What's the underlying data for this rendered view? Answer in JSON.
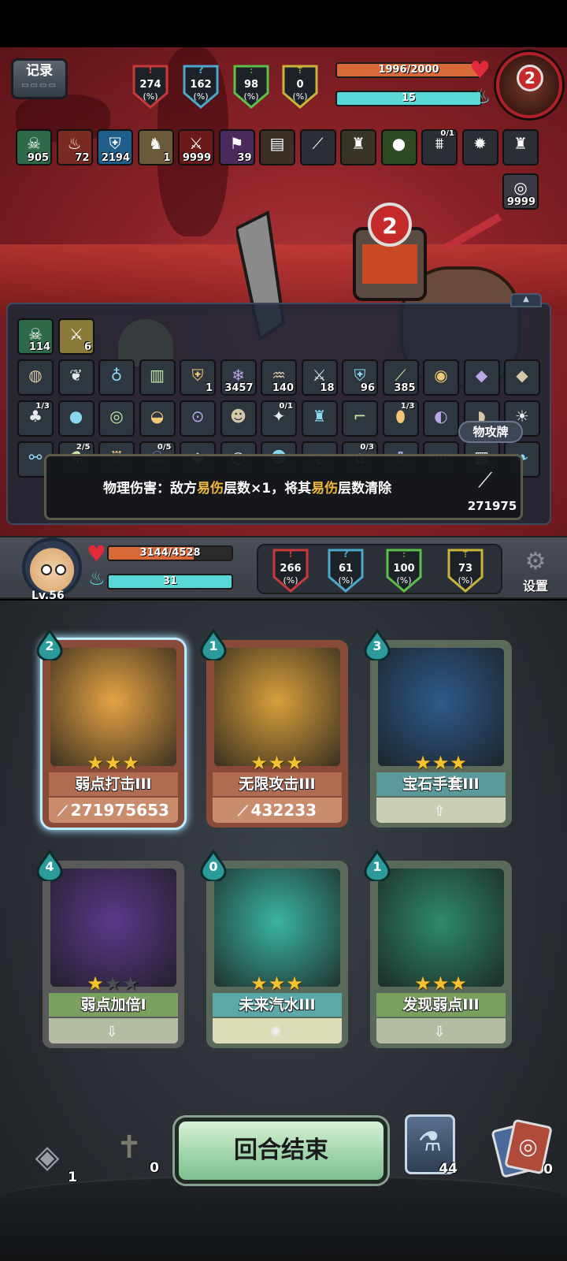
{
  "enemy": {
    "record_label": "记录",
    "hp_text": "1996/2000",
    "hp_fraction": 0.998,
    "mana_text": "15",
    "mana_fraction": 1.0,
    "portrait_number": "2",
    "stats": [
      {
        "icon": "attack-icon",
        "glyph": "!",
        "value": "274",
        "pct": "(%)",
        "color": "#c83a3a"
      },
      {
        "icon": "crit-icon",
        "glyph": "?",
        "value": "162",
        "pct": "(%)",
        "color": "#4aa8c8"
      },
      {
        "icon": "defense-icon",
        "glyph": "⫶",
        "value": "98",
        "pct": "(%)",
        "color": "#5cbf4a"
      },
      {
        "icon": "dodge-icon",
        "glyph": "⇡",
        "value": "0",
        "pct": "(%)",
        "color": "#c8b43a"
      }
    ],
    "status_icons": [
      {
        "name": "skull-icon",
        "glyph": "☠",
        "count": "905",
        "bg": "#2e6a4a"
      },
      {
        "name": "flame-icon",
        "glyph": "♨",
        "count": "72",
        "bg": "#7a2a22"
      },
      {
        "name": "shield-icon",
        "glyph": "⛨",
        "count": "2194",
        "bg": "#1f5e8a"
      },
      {
        "name": "rhino-icon",
        "glyph": "♞",
        "count": "1",
        "bg": "#6a5a3a"
      },
      {
        "name": "claw-icon",
        "glyph": "⚔",
        "count": "9999",
        "bg": "#6a1a1a"
      },
      {
        "name": "demon-icon",
        "glyph": "⚑",
        "count": "39",
        "bg": "#4a2a5a"
      },
      {
        "name": "book-icon",
        "glyph": "▤",
        "count": "",
        "bg": "#3a3026"
      },
      {
        "name": "tusk-icon",
        "glyph": "⟋",
        "count": "",
        "bg": "#2c2e36"
      },
      {
        "name": "armor-icon",
        "glyph": "♜",
        "count": "",
        "bg": "#3a3428"
      },
      {
        "name": "slime-icon",
        "glyph": "●",
        "count": "",
        "bg": "#2e4a22"
      },
      {
        "name": "jaw-icon",
        "glyph": "⩩",
        "count": "",
        "top": "0/1",
        "bg": "#2c2e36"
      },
      {
        "name": "spike-icon",
        "glyph": "✹",
        "count": "",
        "bg": "#2c2e36"
      },
      {
        "name": "boar-icon",
        "glyph": "♜",
        "count": "",
        "bg": "#2c2e36"
      }
    ],
    "extra_icon": {
      "name": "vortex-icon",
      "glyph": "◎",
      "count": "9999"
    }
  },
  "inventory": {
    "header_icons": [
      {
        "name": "skull-icon",
        "glyph": "☠",
        "count": "114",
        "bg": "#2e6a4a"
      },
      {
        "name": "sword-icon",
        "glyph": "⚔",
        "count": "6",
        "bg": "#8a7a3a"
      }
    ],
    "rows": [
      [
        {
          "name": "shield-wood-icon",
          "glyph": "◍",
          "count": ""
        },
        {
          "name": "wings-icon",
          "glyph": "❦",
          "count": ""
        },
        {
          "name": "bag-icon",
          "glyph": "♁",
          "count": ""
        },
        {
          "name": "scroll-icon",
          "glyph": "▥",
          "count": ""
        },
        {
          "name": "ice-shield-icon",
          "glyph": "⛨",
          "count": "1"
        },
        {
          "name": "frost-icon",
          "glyph": "❄",
          "count": "3457"
        },
        {
          "name": "poison-icon",
          "glyph": "♒",
          "count": "140"
        },
        {
          "name": "bleed-icon",
          "glyph": "⚔",
          "count": "18"
        },
        {
          "name": "block-icon",
          "glyph": "⛨",
          "count": "96"
        },
        {
          "name": "slash-icon",
          "glyph": "⟋",
          "count": "385"
        },
        {
          "name": "eye-icon",
          "glyph": "◉",
          "count": ""
        },
        {
          "name": "crystal-icon",
          "glyph": "◆",
          "count": ""
        },
        {
          "name": "crystal-icon",
          "glyph": "◆",
          "count": ""
        }
      ],
      [
        {
          "name": "plant-icon",
          "glyph": "♣",
          "count": "",
          "top": "1/3"
        },
        {
          "name": "bomb-icon",
          "glyph": "●",
          "count": ""
        },
        {
          "name": "nest-icon",
          "glyph": "◎",
          "count": ""
        },
        {
          "name": "helmet-icon",
          "glyph": "◒",
          "count": ""
        },
        {
          "name": "goggles-icon",
          "glyph": "⊙",
          "count": ""
        },
        {
          "name": "monster-icon",
          "glyph": "☻",
          "count": ""
        },
        {
          "name": "pacifier-icon",
          "glyph": "✦",
          "count": "",
          "top": "0/1"
        },
        {
          "name": "armor-icon",
          "glyph": "♜",
          "count": ""
        },
        {
          "name": "gun-icon",
          "glyph": "⌐",
          "count": ""
        },
        {
          "name": "egg-icon",
          "glyph": "⬮",
          "count": "",
          "top": "1/3"
        },
        {
          "name": "pan-icon",
          "glyph": "◐",
          "count": ""
        },
        {
          "name": "meat-icon",
          "glyph": "◗",
          "count": ""
        },
        {
          "name": "sun-icon",
          "glyph": "☀",
          "count": ""
        }
      ],
      [
        {
          "name": "bone-icon",
          "glyph": "⚯",
          "count": ""
        },
        {
          "name": "potion-icon",
          "glyph": "⚗",
          "count": "",
          "top": "2/5"
        },
        {
          "name": "cup-icon",
          "glyph": "♖",
          "count": ""
        },
        {
          "name": "skull-cup-icon",
          "glyph": "☠",
          "count": "",
          "top": "0/5"
        },
        {
          "name": "gem-icon",
          "glyph": "◆",
          "count": ""
        },
        {
          "name": "ring-icon",
          "glyph": "○",
          "count": ""
        },
        {
          "name": "mask-icon",
          "glyph": "☻",
          "count": ""
        },
        {
          "name": "boot-icon",
          "glyph": "⌞",
          "count": ""
        },
        {
          "name": "hat-icon",
          "glyph": "⌂",
          "count": "",
          "top": "0/3"
        },
        {
          "name": "jar-icon",
          "glyph": "⚱",
          "count": ""
        },
        {
          "name": "chain-icon",
          "glyph": "∞",
          "count": ""
        },
        {
          "name": "chip-icon",
          "glyph": "▦",
          "count": ""
        },
        {
          "name": "feather-icon",
          "glyph": "❧",
          "count": ""
        }
      ]
    ],
    "tag_label": "物攻牌"
  },
  "tooltip": {
    "prefix": "物理伤害：敌方",
    "hl1": "易伤",
    "mid": "层数×1，将其",
    "hl2": "易伤",
    "suffix": "层数清除",
    "damage": "271975"
  },
  "player": {
    "level": "Lv.56",
    "hp_text": "3144/4528",
    "hp_fraction": 0.694,
    "mana_text": "31",
    "mana_fraction": 1.0,
    "stats": [
      {
        "icon": "attack-icon",
        "glyph": "!",
        "value": "266",
        "pct": "(%)",
        "color": "#c83a3a"
      },
      {
        "icon": "crit-icon",
        "glyph": "?",
        "value": "61",
        "pct": "(%)",
        "color": "#4aa8c8"
      },
      {
        "icon": "defense-icon",
        "glyph": "⫶",
        "value": "100",
        "pct": "(%)",
        "color": "#5cbf4a"
      },
      {
        "icon": "dodge-icon",
        "glyph": "⇡",
        "value": "73",
        "pct": "(%)",
        "color": "#c8b43a"
      }
    ],
    "settings_label": "设置"
  },
  "hand": [
    {
      "name": "弱点打击III",
      "cost": "2",
      "stars": 3,
      "foot": "271975653",
      "foot_icon": "attack",
      "frame": "#8a4a3a",
      "art": "#e6a444",
      "band": "#b06c50",
      "foot_bg": "#c98d6e",
      "selected": true
    },
    {
      "name": "无限攻击III",
      "cost": "1",
      "stars": 3,
      "foot": "432233",
      "foot_icon": "attack",
      "frame": "#8a4a3a",
      "art": "#d8a03c",
      "band": "#b06c50",
      "foot_bg": "#c98d6e",
      "selected": false
    },
    {
      "name": "宝石手套III",
      "cost": "3",
      "stars": 3,
      "foot": "",
      "foot_icon": "up",
      "frame": "#5c6a5a",
      "art": "#2e5a8a",
      "band": "#5a9a9a",
      "foot_bg": "#c9cfb4",
      "selected": false
    },
    {
      "name": "弱点加倍I",
      "cost": "4",
      "stars": 1,
      "foot": "",
      "foot_icon": "down",
      "frame": "#5a5a5a",
      "art": "#5a3a8a",
      "band": "#7aa060",
      "foot_bg": "#b4bca4",
      "selected": false
    },
    {
      "name": "未来汽水III",
      "cost": "0",
      "stars": 3,
      "foot": "",
      "foot_icon": "bulb",
      "frame": "#5a6a5a",
      "art": "#3ab4a0",
      "band": "#5aa8a8",
      "foot_bg": "#dcdcb8",
      "selected": false
    },
    {
      "name": "发现弱点III",
      "cost": "1",
      "stars": 3,
      "foot": "",
      "foot_icon": "down",
      "frame": "#5a6a5a",
      "art": "#2e8a6a",
      "band": "#7aa060",
      "foot_bg": "#b4bca4",
      "selected": false
    }
  ],
  "bottom": {
    "draw_pile_count": "1",
    "grave_count": "0",
    "end_turn_label": "回合结束",
    "deck_count": "44",
    "discard_count": "0"
  }
}
